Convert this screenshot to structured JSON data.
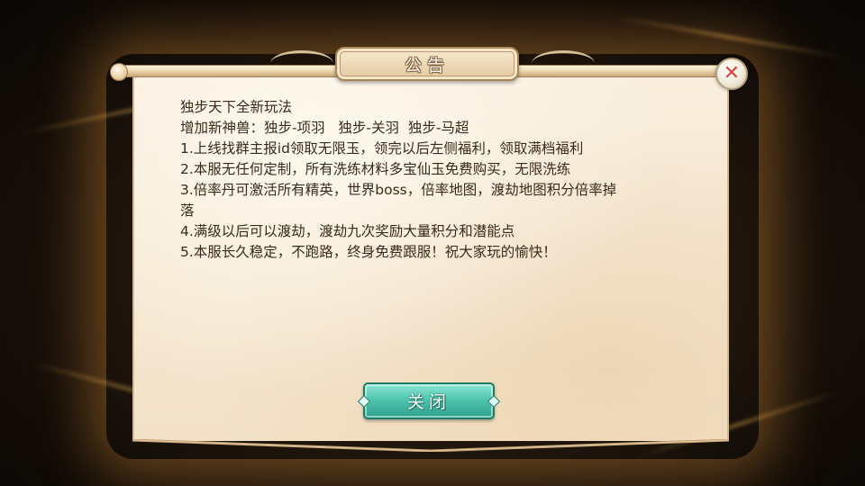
{
  "dialog": {
    "title": "公告",
    "close_button_label": "关闭",
    "close_icon": "close-x-icon"
  },
  "notice": {
    "lines": [
      "独步天下全新玩法",
      "增加新神兽：独步-项羽   独步-关羽  独步-马超",
      "1.上线找群主报id领取无限玉，领完以后左侧福利，领取满档福利",
      "2.本服无任何定制，所有洗练材料多宝仙玉免费购买，无限洗练",
      "3.倍率丹可激活所有精英，世界boss，倍率地图，渡劫地图积分倍率掉",
      "落",
      "4.满级以后可以渡劫，渡劫九次奖励大量积分和潜能点",
      "5.本服长久稳定，不跑路，终身免费跟服！祝大家玩的愉快！"
    ]
  },
  "colors": {
    "paper": "#f6e8d2",
    "text": "#3a2a1a",
    "button": "#4fc6b0",
    "close_x": "#e0413a"
  }
}
